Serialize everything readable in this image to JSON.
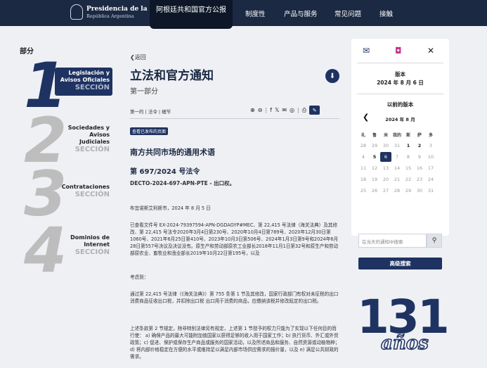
{
  "nav": {
    "brand_title": "Presidencia de la Nación",
    "brand_sub": "República Argentina",
    "active_tab": "阿根廷共和国官方公报",
    "menu": [
      "制度性",
      "产品与服务",
      "常见问题",
      "接触"
    ]
  },
  "sidebar": {
    "title": "部分",
    "sections": [
      {
        "num": "1",
        "label": "Legislación y Avisos Oficiales",
        "sub": "SECCIÓN",
        "active": true
      },
      {
        "num": "2",
        "label": "Sociedades y Avisos Judiciales",
        "sub": "SECCIÓN",
        "active": false
      },
      {
        "num": "3",
        "label": "Contrataciones",
        "sub": "SECCIÓN",
        "active": false
      },
      {
        "num": "4",
        "label": "Dominios de Internet",
        "sub": "SECCIÓN",
        "active": false
      }
    ]
  },
  "main": {
    "back": "返回",
    "title": "立法和官方通知",
    "subtitle": "第一部分",
    "breadcrumbs": "第一的  |  法令  |  细节",
    "badge": "查看已发布的页面",
    "article_title": "南方共同市场的通用术语",
    "decree": "第 697/2024 号法令",
    "decree_code": "DECTO-2024-697-APN-PTE - 出口权。",
    "place_date": "布宜诺斯艾利斯市，2024 年 8 月 5 日",
    "para1": "已查看文件号 EX-2024-79397594-APN-DGDAGYP#MEC、第 22,415 号法律（海关法典）及其修改、第 22,415 号法令2020年3月4日第230号、2020年10月4日第789号、2020年12月30日第1060号、2021年6月25日第410号、2023年10月3日第506号、2024年1月3日第9号和2024年6月28日第557号决议及决议没有。原生产和劳动部原农工业部长2018年11月1日第32号和原生产和劳动部原农业、畜牧业和渔业部长2019年10月22日第195号，以及",
    "considering": "考虑到：",
    "para2": "通过第 22,415 号法律（《海关法典》）第 755 条第 1 节及其修改，国家行政部门有权对未征税的出口消费商品征收出口税，并扣除出口税 出口用于消费的商品，应缴纳该税并修改既定的出口税。",
    "para3": "上述条款第 2 节规定，除非特别法律另有规定，上述第 1 节授予的权力只能为了实现以下任何目的而行使： a) 确保产品的最大可能附加值国家以获得足够的收入用于国家工作；b) 执行货币、外汇或外贸政策；c) 促进、保护或保存生产商品或服务的国家活动，以及所述商品和服务、自然资源或动植物种；d) 将内部价格稳定在方便的水平或维持足以满足内部市场供应需求的报价量，以及 e) 满足公共财政的需求。"
  },
  "right": {
    "social": [
      "envelope-icon",
      "instagram-icon",
      "x-icon"
    ],
    "version_label": "版本",
    "version_date": "2024 年 8 月 6 日",
    "prev_label": "以前的版本",
    "month": "2024 年 8 月",
    "weekdays": [
      "礼",
      "鲁",
      "米",
      "我的",
      "斯",
      "萨",
      "多"
    ],
    "weeks": [
      [
        "28",
        "29",
        "30",
        "31",
        "1",
        "2",
        "3"
      ],
      [
        "4",
        "5",
        "6",
        "7",
        "8",
        "9",
        "10"
      ],
      [
        "11",
        "12",
        "13",
        "14",
        "15",
        "16",
        "17"
      ],
      [
        "18",
        "19",
        "20",
        "21",
        "22",
        "23",
        "24"
      ],
      [
        "25",
        "26",
        "27",
        "28",
        "29",
        "30",
        "31"
      ]
    ],
    "search_placeholder": "在当天的通知中搜索",
    "advanced_search": "高级搜索",
    "anniv_number": "131",
    "anniv_word": "años"
  },
  "colors": {
    "navy": "#1b2942",
    "accent": "#1f3362",
    "background": "#eef0f4"
  }
}
